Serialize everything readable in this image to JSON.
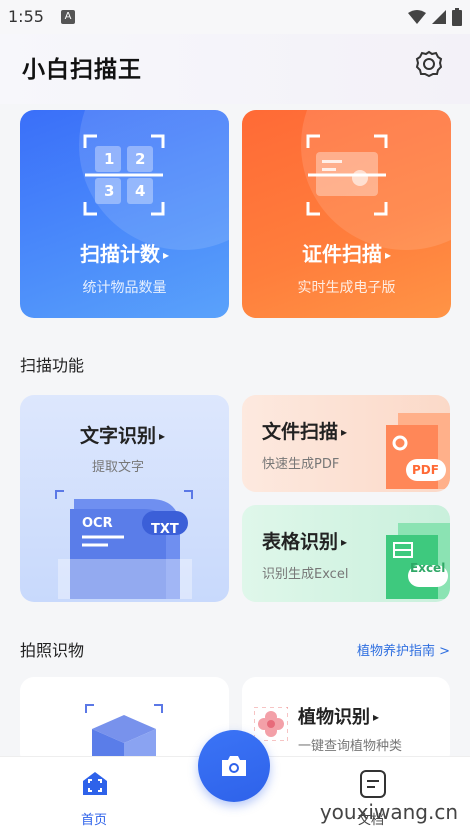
{
  "status_bar": {
    "time": "1:55",
    "a_badge": "A"
  },
  "header": {
    "app_title": "小白扫描王",
    "settings_icon": "gear-icon"
  },
  "scan_cards": [
    {
      "title": "扫描计数",
      "subtitle": "统计物品数量",
      "grid": [
        "1",
        "2",
        "3",
        "4"
      ],
      "color": "#3a6ff9"
    },
    {
      "title": "证件扫描",
      "subtitle": "实时生成电子版",
      "color": "#ff6a36"
    }
  ],
  "sections": {
    "scan_features": "扫描功能",
    "photo_recognition": "拍照识物",
    "plant_guide_link": "植物养护指南 >"
  },
  "features": [
    {
      "title": "文字识别",
      "subtitle": "提取文字",
      "badge1": "OCR",
      "badge2": "TXT"
    },
    {
      "title": "文件扫描",
      "subtitle": "快速生成PDF",
      "badge": "PDF"
    },
    {
      "title": "表格识别",
      "subtitle": "识别生成Excel",
      "badge": "Excel"
    }
  ],
  "photo_cards": [
    {
      "title": "",
      "icon": "box-scan-icon"
    },
    {
      "title": "植物识别",
      "subtitle": "一键查询植物种类"
    }
  ],
  "tabbar": {
    "home": "首页",
    "docs": "文档"
  },
  "watermark": "youxiwang.cn"
}
